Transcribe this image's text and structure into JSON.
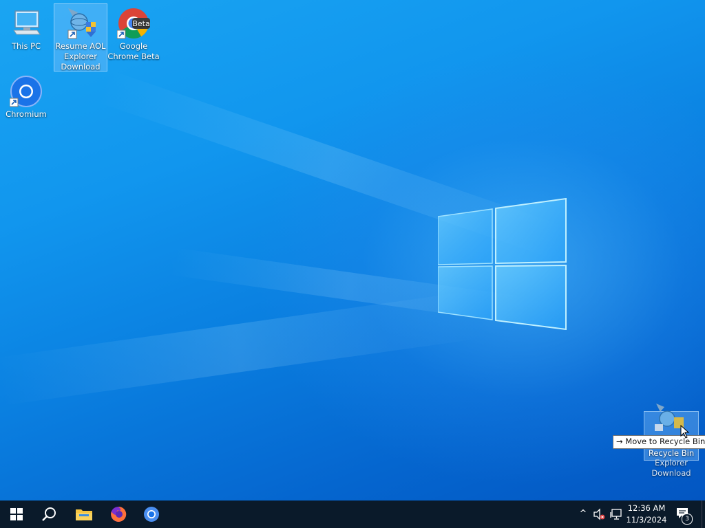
{
  "desktop": {
    "icons": [
      {
        "label": "This PC",
        "icon": "this-pc-icon"
      },
      {
        "label": "Resume AOL Explorer Download",
        "icon": "aol-explorer-icon"
      },
      {
        "label": "Google Chrome Beta",
        "icon": "chrome-beta-icon",
        "badge": "Beta"
      },
      {
        "label": "Chromium",
        "icon": "chromium-icon"
      }
    ],
    "drag": {
      "target_label": "Recycle Bin",
      "dragged_label": "Explorer Download",
      "tooltip_arrow": "→",
      "tooltip": "Move to Recycle Bin"
    }
  },
  "taskbar": {
    "start": "start-icon",
    "search": "search-icon",
    "pinned": [
      {
        "name": "File Explorer",
        "icon": "file-explorer-icon"
      },
      {
        "name": "Firefox",
        "icon": "firefox-icon"
      },
      {
        "name": "Chromium",
        "icon": "chromium-icon"
      }
    ],
    "tray": {
      "chevron": "^",
      "time": "12:36 AM",
      "date": "11/3/2024",
      "notifications_count": "3"
    }
  },
  "colors": {
    "taskbar": "#0a1a2a",
    "desktop_accent": "#0a7fe0",
    "selection": "#8cc8ff"
  }
}
